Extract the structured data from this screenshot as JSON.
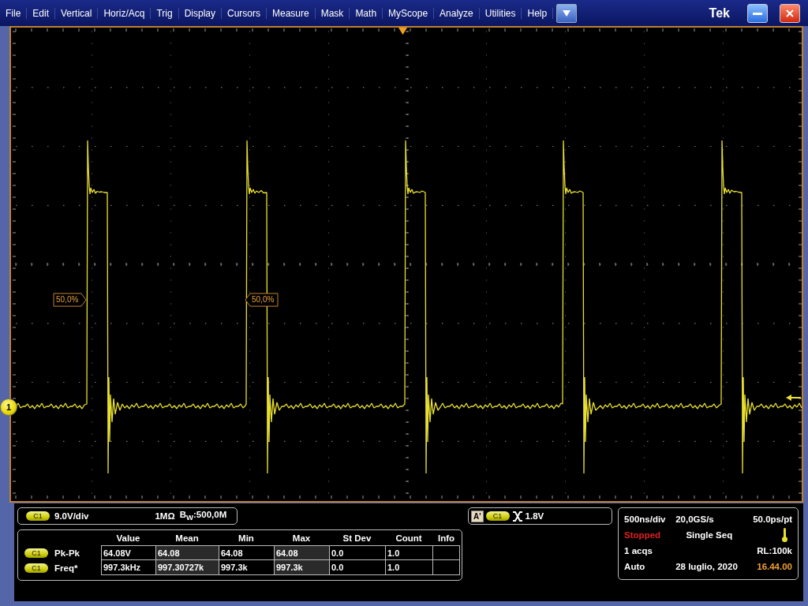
{
  "menu_bar": {
    "items": [
      "File",
      "Edit",
      "Vertical",
      "Horiz/Acq",
      "Trig",
      "Display",
      "Cursors",
      "Measure",
      "Mask",
      "Math",
      "MyScope",
      "Analyze",
      "Utilities",
      "Help"
    ],
    "brand": "Tek"
  },
  "screen": {
    "channel_marker": "1",
    "cursor_labels": [
      {
        "text": "50,0%",
        "kind": "right"
      },
      {
        "text": "50,0%",
        "kind": "left"
      }
    ]
  },
  "channel_readout": {
    "channel": "C1",
    "scale": "9.0V/div",
    "impedance": "1MΩ",
    "bandwidth": "B$_{W}$:500,0M"
  },
  "measurements": {
    "columns": [
      "Value",
      "Mean",
      "Min",
      "Max",
      "St Dev",
      "Count",
      "Info"
    ],
    "rows": [
      {
        "channel": "C1",
        "name": "Pk-Pk",
        "cells": [
          "64.08V",
          "64.08",
          "64.08",
          "64.08",
          "0.0",
          "1.0"
        ]
      },
      {
        "channel": "C1",
        "name": "Freq*",
        "cells": [
          "997.3kHz",
          "997.30727k",
          "997.3k",
          "997.3k",
          "0.0",
          "1.0"
        ]
      }
    ]
  },
  "trigger_readout": {
    "source_badge": "A'",
    "channel": "C1",
    "level": "1.8V"
  },
  "acquisition": {
    "timebase": "500ns/div",
    "sample_rate": "20,0GS/s",
    "resolution": "50.0ps/pt",
    "state": "Stopped",
    "mode": "Single Seq",
    "acquisitions": "1 acqs",
    "record_length": "RL:100k",
    "trigger_mode": "Auto",
    "date": "28 luglio, 2020",
    "time": "16.44.00"
  }
}
